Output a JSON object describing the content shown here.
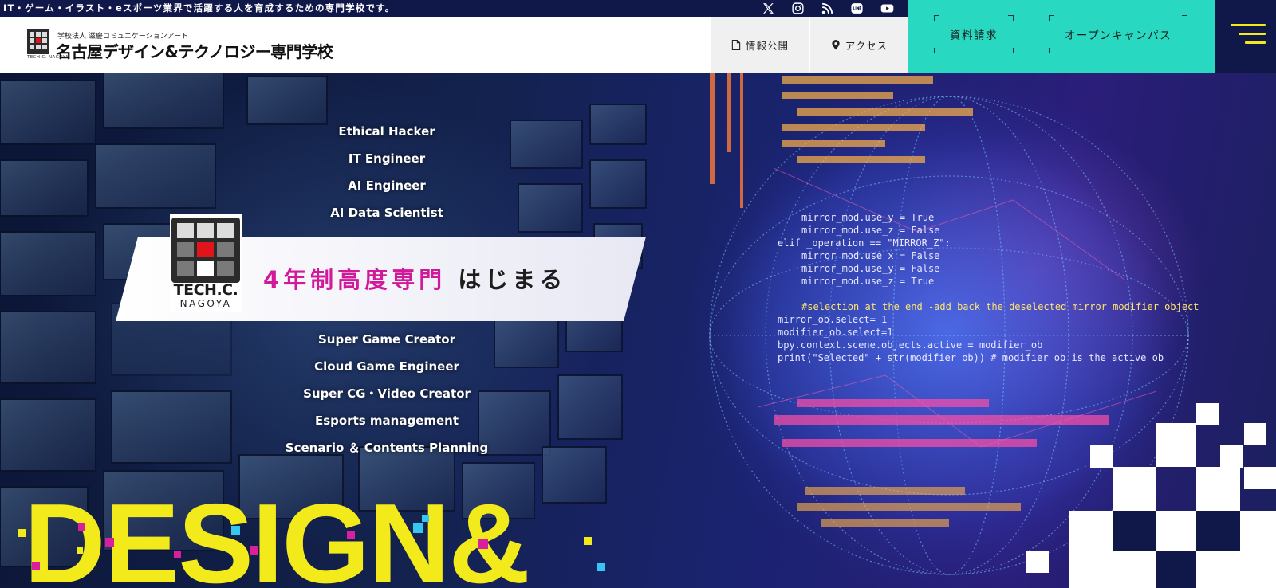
{
  "topbar": {
    "tagline": "IT・ゲーム・イラスト・eスポーツ業界で活躍する人を育成するための専門学校です。",
    "social": [
      {
        "name": "x-icon"
      },
      {
        "name": "instagram-icon"
      },
      {
        "name": "rss-icon"
      },
      {
        "name": "line-icon"
      },
      {
        "name": "youtube-icon"
      }
    ]
  },
  "header": {
    "logo": {
      "corporation": "学校法人 滋慶コミュニケーションアート",
      "name": "名古屋デザイン&テクノロジー専門学校",
      "mark_label": "TECH.C. NAGOYA"
    },
    "info_label": "情報公開",
    "access_label": "アクセス",
    "request_label": "資料請求",
    "open_campus_label": "オープンキャンパス"
  },
  "hero": {
    "roles_top": [
      "Ethical Hacker",
      "IT Engineer",
      "AI Engineer",
      "AI Data Scientist"
    ],
    "roles_bottom": [
      "Super Game Creator",
      "Cloud Game Engineer",
      "Super CG・Video Creator",
      "Esports management",
      "Scenario ＆ Contents Planning"
    ],
    "banner": {
      "logo_line1": "TECH.C.",
      "logo_line2": "NAGOYA",
      "highlight": "4年制高度専門",
      "rest": "はじまる"
    },
    "headline": "DESIGN&"
  },
  "colors": {
    "navy": "#10184a",
    "teal": "#29d8c0",
    "yellow": "#f3ea1c",
    "pink": "#d2199a"
  },
  "code_lines": [
    "mirror_mod.use_y = True",
    "mirror_mod.use_z = False",
    "elif _operation == \"MIRROR_Z\":",
    "mirror_mod.use_x = False",
    "mirror_mod.use_y = False",
    "mirror_mod.use_z = True",
    "#selection at the end -add back the deselected mirror modifier object",
    "mirror_ob.select= 1",
    "modifier_ob.select=1",
    "bpy.context.scene.objects.active = modifier_ob",
    "print(\"Selected\" + str(modifier_ob)) # modifier ob is the active ob"
  ]
}
